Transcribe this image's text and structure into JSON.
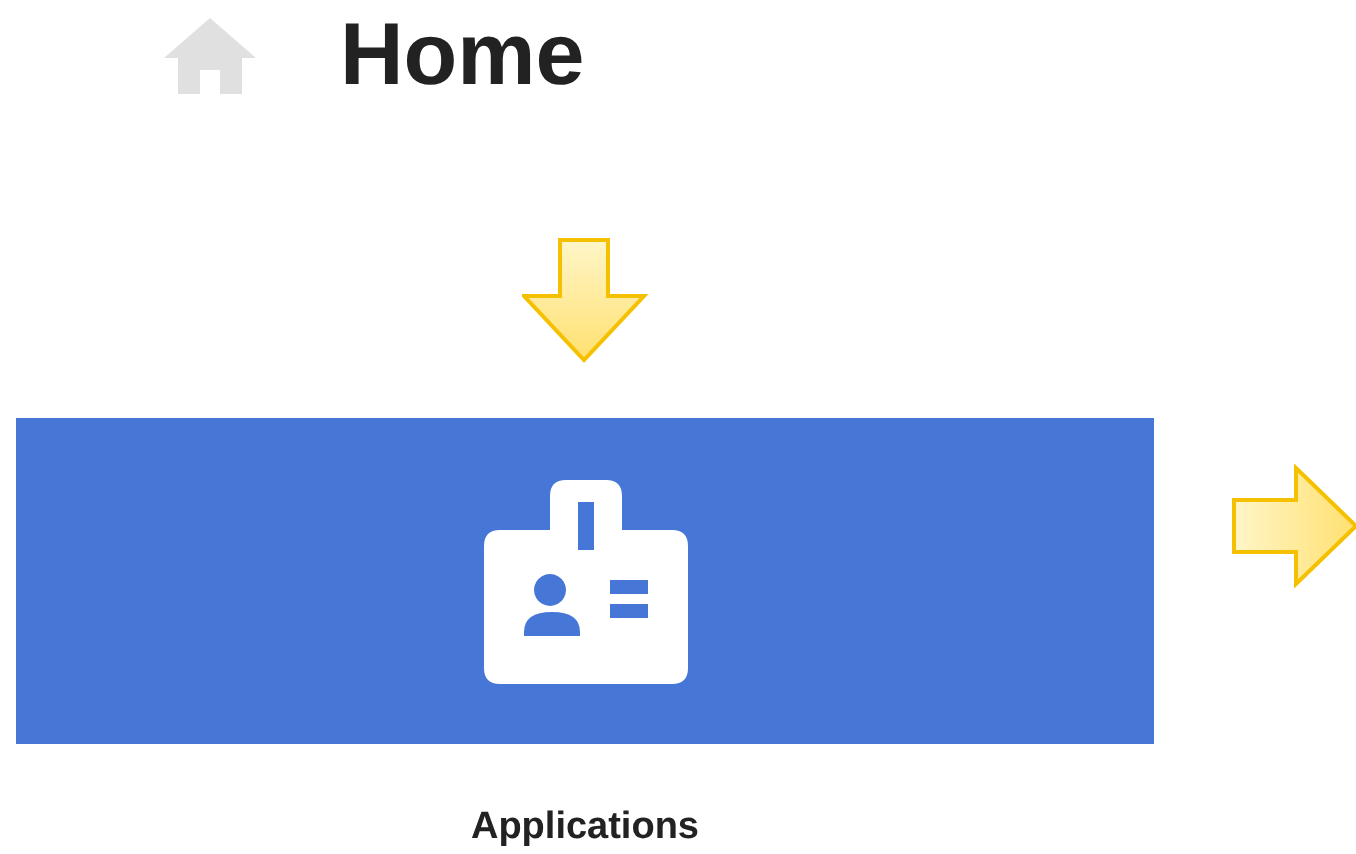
{
  "header": {
    "title": "Home"
  },
  "tiles": [
    {
      "label": "Applications"
    }
  ]
}
